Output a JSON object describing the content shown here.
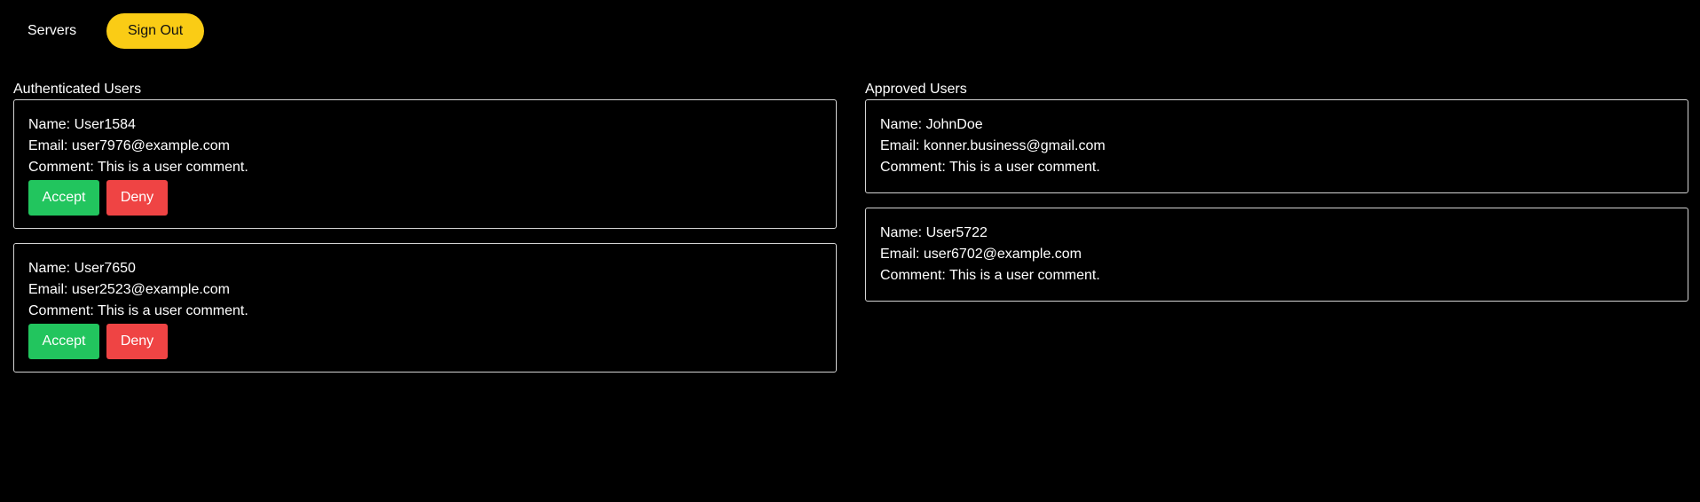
{
  "nav": {
    "servers_label": "Servers",
    "signout_label": "Sign Out"
  },
  "authenticated": {
    "title": "Authenticated Users",
    "users": [
      {
        "name": "Name: User1584",
        "email": "Email: user7976@example.com",
        "comment": "Comment: This is a user comment.",
        "accept_label": "Accept",
        "deny_label": "Deny"
      },
      {
        "name": "Name: User7650",
        "email": "Email: user2523@example.com",
        "comment": "Comment: This is a user comment.",
        "accept_label": "Accept",
        "deny_label": "Deny"
      }
    ]
  },
  "approved": {
    "title": "Approved Users",
    "users": [
      {
        "name": "Name: JohnDoe",
        "email": "Email: konner.business@gmail.com",
        "comment": "Comment: This is a user comment."
      },
      {
        "name": "Name: User5722",
        "email": "Email: user6702@example.com",
        "comment": "Comment: This is a user comment."
      }
    ]
  },
  "colors": {
    "background": "#000000",
    "signout": "#facc15",
    "accept": "#22c55e",
    "deny": "#ef4444",
    "border": "#d4d4d4"
  }
}
